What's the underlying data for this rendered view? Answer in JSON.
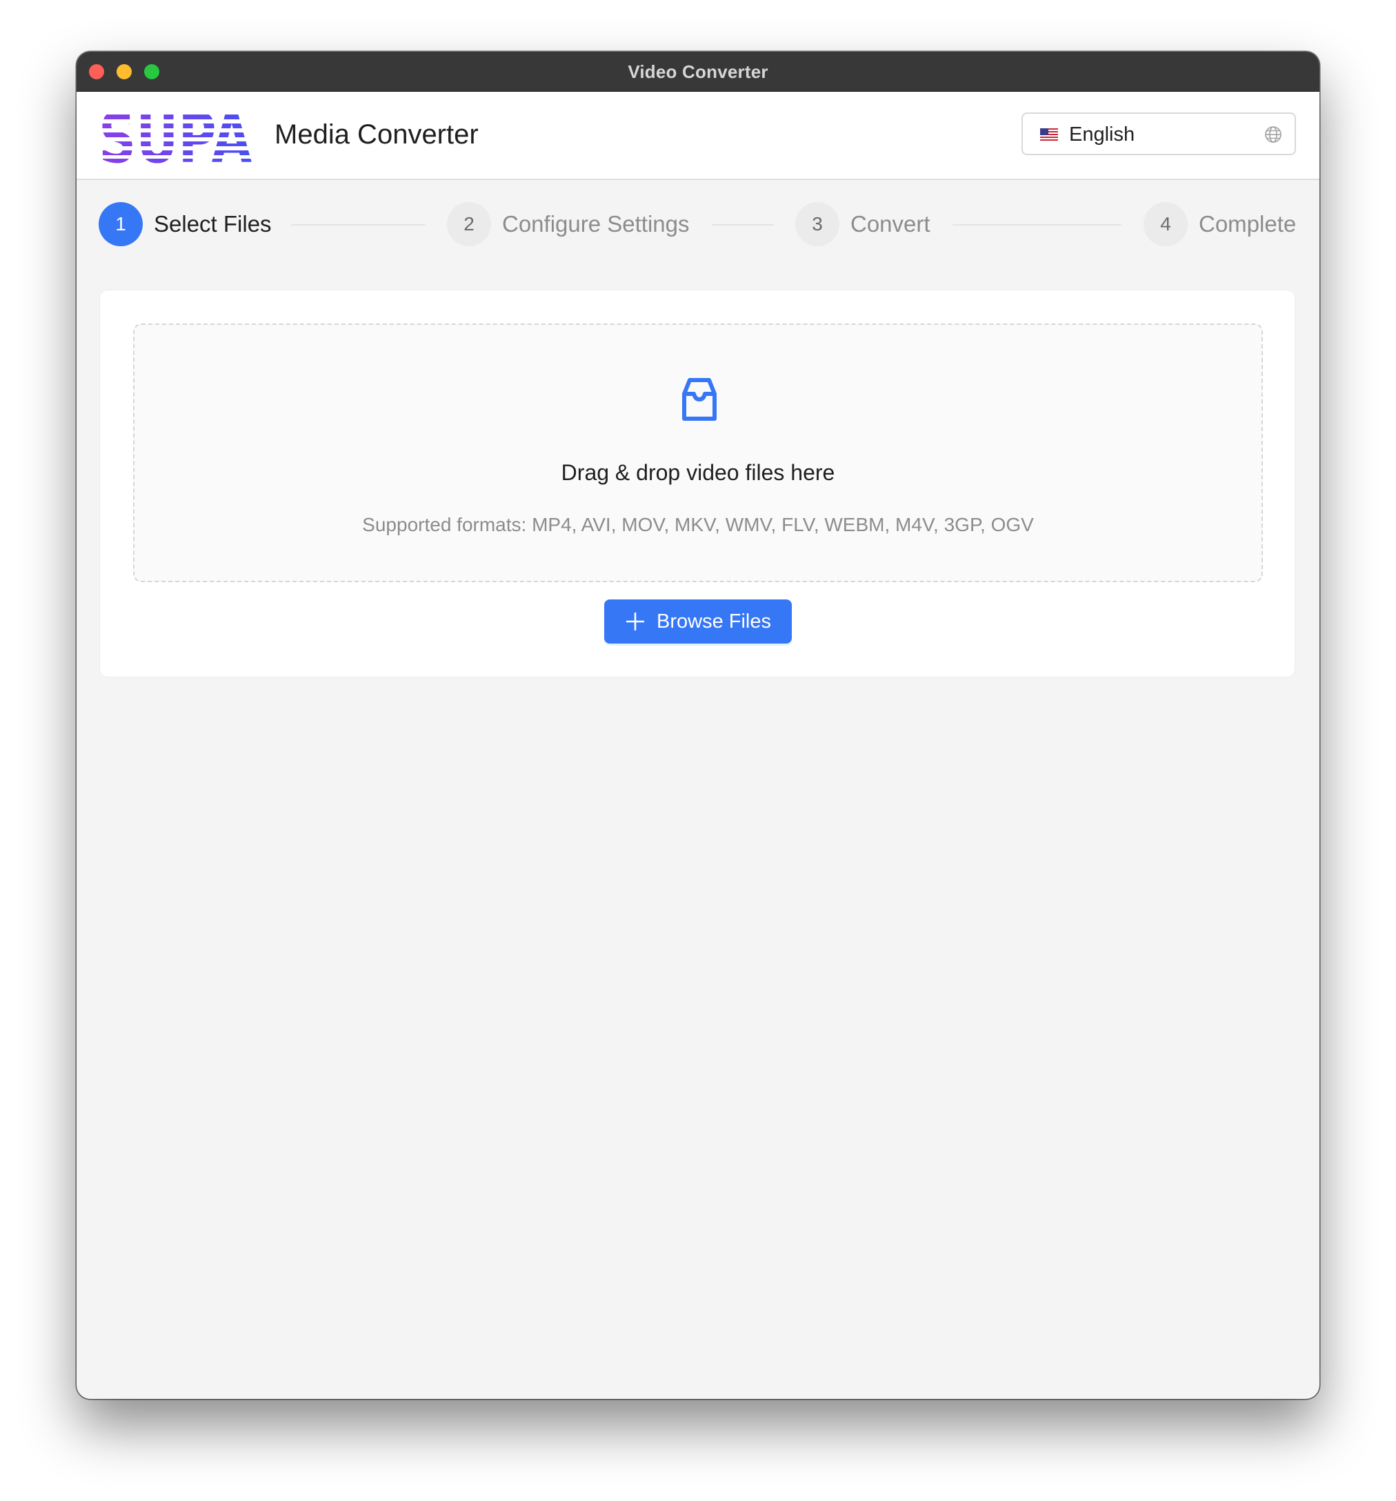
{
  "window": {
    "title": "Video Converter"
  },
  "header": {
    "logo_text": "SUPA",
    "app_name": "Media Converter",
    "language": {
      "selected": "English",
      "flag_icon": "us-flag-icon",
      "trailing_icon": "globe-icon"
    }
  },
  "steps": [
    {
      "number": "1",
      "label": "Select Files",
      "state": "active"
    },
    {
      "number": "2",
      "label": "Configure Settings",
      "state": "inactive"
    },
    {
      "number": "3",
      "label": "Convert",
      "state": "inactive"
    },
    {
      "number": "4",
      "label": "Complete",
      "state": "inactive"
    }
  ],
  "upload": {
    "icon": "inbox-icon",
    "title": "Drag & drop video files here",
    "hint": "Supported formats: MP4, AVI, MOV, MKV, WMV, FLV, WEBM, M4V, 3GP, OGV",
    "browse_label": "Browse Files",
    "browse_icon": "plus-icon"
  },
  "colors": {
    "accent": "#3677f6",
    "logo_gradient_start": "#8a3ee8",
    "logo_gradient_end": "#4a4ff0",
    "titlebar": "#383838",
    "window_background": "#f4f4f4"
  }
}
